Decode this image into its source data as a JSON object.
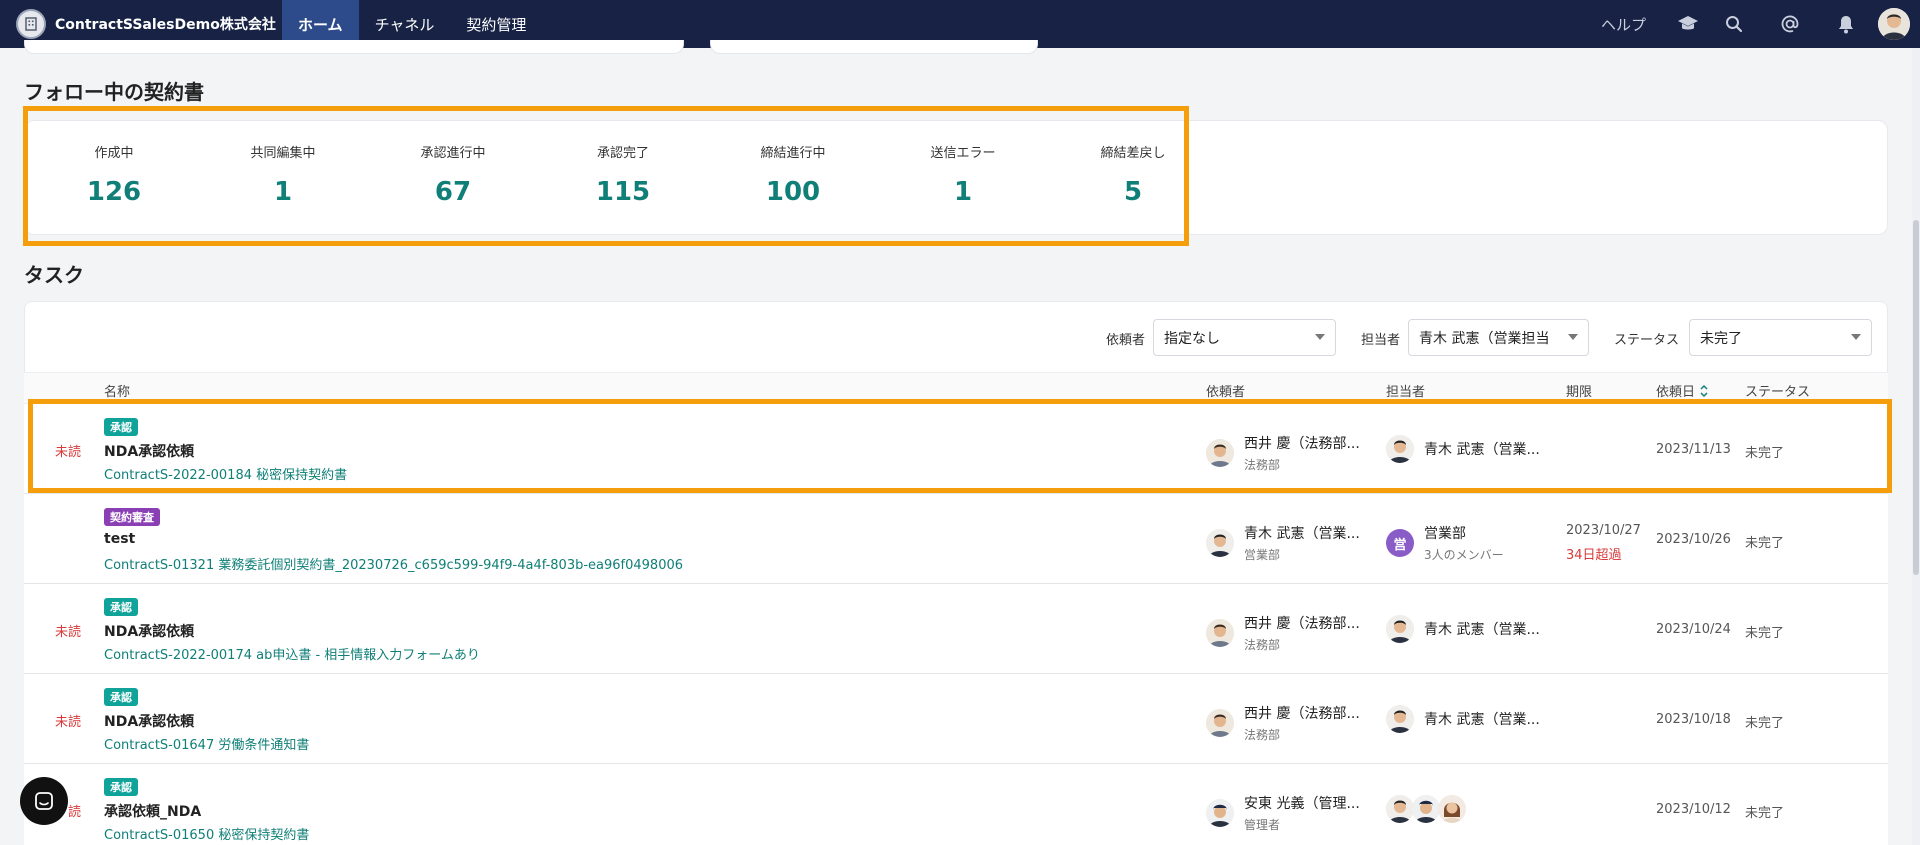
{
  "nav": {
    "brand": "ContractSSalesDemo株式会社",
    "tabs": [
      {
        "label": "ホーム",
        "active": true
      },
      {
        "label": "チャネル",
        "active": false
      },
      {
        "label": "契約管理",
        "active": false
      }
    ],
    "help": "ヘルプ",
    "icons": [
      "graduation-cap-icon",
      "search-icon",
      "at-sign-icon",
      "bell-icon",
      "avatar"
    ]
  },
  "follow": {
    "title": "フォロー中の契約書",
    "stats": [
      {
        "label": "作成中",
        "value": "126"
      },
      {
        "label": "共同編集中",
        "value": "1"
      },
      {
        "label": "承認進行中",
        "value": "67"
      },
      {
        "label": "承認完了",
        "value": "115"
      },
      {
        "label": "締結進行中",
        "value": "100"
      },
      {
        "label": "送信エラー",
        "value": "1"
      },
      {
        "label": "締結差戻し",
        "value": "5"
      }
    ]
  },
  "tasks": {
    "title": "タスク",
    "filters": {
      "requester_label": "依頼者",
      "requester_value": "指定なし",
      "assignee_label": "担当者",
      "assignee_value": "青木 武憲（営業担当",
      "status_label": "ステータス",
      "status_value": "未完了"
    },
    "columns": {
      "name": "名称",
      "requester": "依頼者",
      "assignee": "担当者",
      "due": "期限",
      "requested": "依頼日",
      "status": "ステータス"
    },
    "rows": [
      {
        "unread": "未読",
        "badge": "承認",
        "name": "NDA承認依頼",
        "link": "ContractS-2022-00184 秘密保持契約書",
        "requester_name": "西井 慶（法務部...",
        "requester_dept": "法務部",
        "assignee_name": "青木 武憲（営業...",
        "assignee_sub": "",
        "due": "",
        "overdue": "",
        "requested": "2023/11/13",
        "status": "未完了"
      },
      {
        "unread": "",
        "badge": "契約審査",
        "name": "test",
        "link": "ContractS-01321 業務委託個別契約書_20230726_c659c599-94f9-4a4f-803b-ea96f0498006",
        "requester_name": "青木 武憲（営業...",
        "requester_dept": "営業部",
        "assignee_name": "営業部",
        "assignee_sub": "3人のメンバー",
        "assignee_group_initial": "営",
        "due": "2023/10/27",
        "overdue": "34日超過",
        "requested": "2023/10/26",
        "status": "未完了"
      },
      {
        "unread": "未読",
        "badge": "承認",
        "name": "NDA承認依頼",
        "link": "ContractS-2022-00174 ab申込書 - 相手情報入力フォームあり",
        "requester_name": "西井 慶（法務部...",
        "requester_dept": "法務部",
        "assignee_name": "青木 武憲（営業...",
        "assignee_sub": "",
        "due": "",
        "overdue": "",
        "requested": "2023/10/24",
        "status": "未完了"
      },
      {
        "unread": "未読",
        "badge": "承認",
        "name": "NDA承認依頼",
        "link": "ContractS-01647 労働条件通知書",
        "requester_name": "西井 慶（法務部...",
        "requester_dept": "法務部",
        "assignee_name": "青木 武憲（営業...",
        "assignee_sub": "",
        "due": "",
        "overdue": "",
        "requested": "2023/10/18",
        "status": "未完了"
      },
      {
        "unread": "読",
        "badge": "承認",
        "name": "承認依頼_NDA",
        "link": "ContractS-01650 秘密保持契約書",
        "requester_name": "安東 光義（管理...",
        "requester_dept": "管理者",
        "assignee_name": "",
        "assignee_sub": "",
        "due": "",
        "overdue": "",
        "requested": "2023/10/12",
        "status": "未完了"
      }
    ]
  },
  "colors": {
    "nav_bg": "#172244",
    "nav_active": "#2d4a8a",
    "accent_teal": "#0f7f77",
    "highlight": "#f59e0b",
    "unread_red": "#d83a3a",
    "badge_approve": "#10a39a",
    "badge_review": "#8a3fb5"
  }
}
